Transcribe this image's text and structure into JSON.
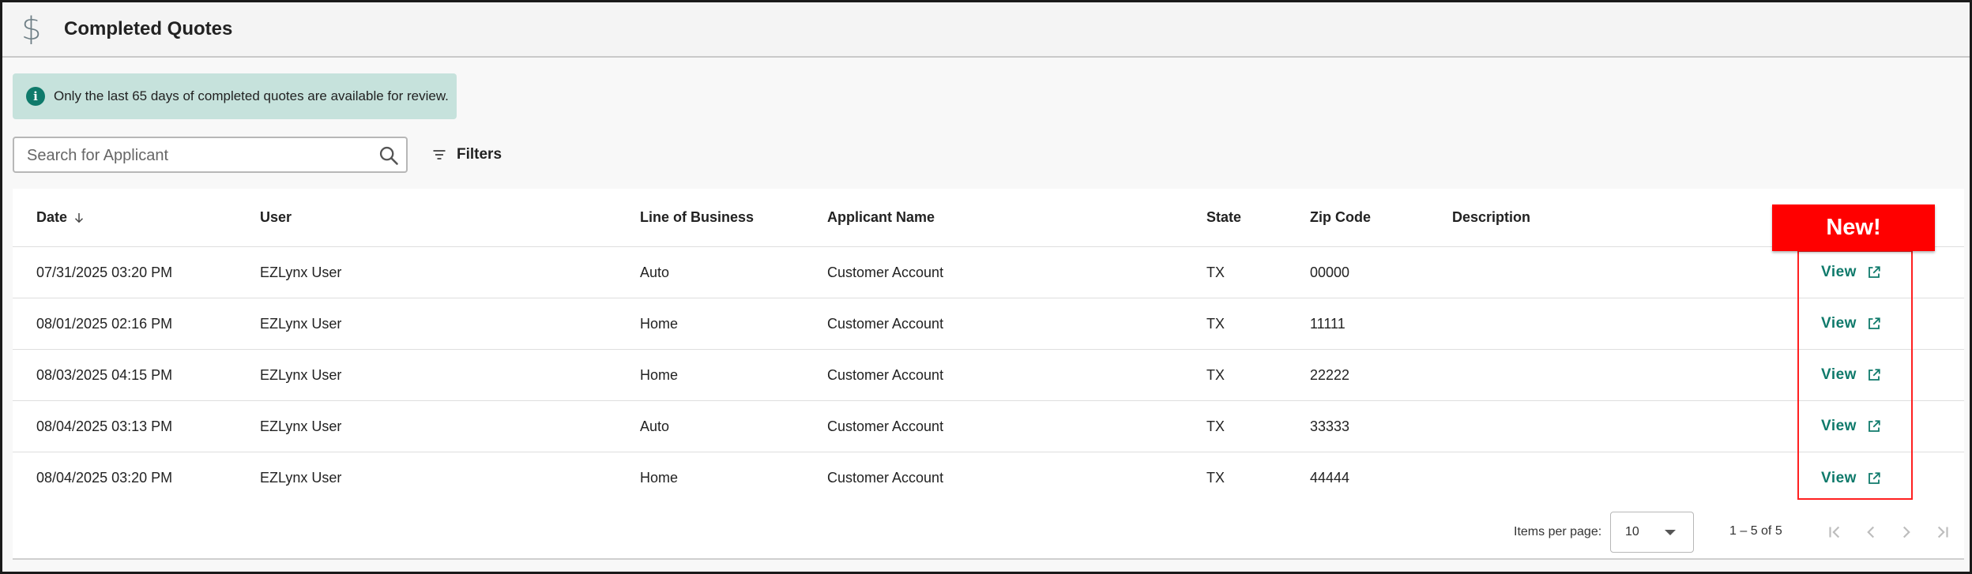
{
  "header": {
    "icon": "dollar-icon",
    "title": "Completed Quotes"
  },
  "notice": {
    "icon": "info-icon",
    "text": "Only the last 65 days of completed quotes are available for review."
  },
  "search": {
    "placeholder": "Search for Applicant",
    "value": "",
    "icon": "search-icon"
  },
  "filters": {
    "icon": "filter-icon",
    "label": "Filters"
  },
  "table": {
    "columns": {
      "date": "Date",
      "user": "User",
      "line_of_business": "Line of Business",
      "applicant_name": "Applicant Name",
      "state": "State",
      "zip_code": "Zip Code",
      "description": "Description"
    },
    "sort": {
      "column": "date",
      "direction": "descending",
      "icon": "arrow-down-icon"
    },
    "rows": [
      {
        "date": "07/31/2025 03:20 PM",
        "user": "EZLynx User",
        "line_of_business": "Auto",
        "applicant_name": "Customer Account",
        "state": "TX",
        "zip_code": "00000",
        "description": "",
        "action": "View"
      },
      {
        "date": "08/01/2025 02:16 PM",
        "user": "EZLynx User",
        "line_of_business": "Home",
        "applicant_name": "Customer Account",
        "state": "TX",
        "zip_code": "11111",
        "description": "",
        "action": "View"
      },
      {
        "date": "08/03/2025 04:15 PM",
        "user": "EZLynx User",
        "line_of_business": "Home",
        "applicant_name": "Customer Account",
        "state": "TX",
        "zip_code": "22222",
        "description": "",
        "action": "View"
      },
      {
        "date": "08/04/2025 03:13 PM",
        "user": "EZLynx User",
        "line_of_business": "Auto",
        "applicant_name": "Customer Account",
        "state": "TX",
        "zip_code": "33333",
        "description": "",
        "action": "View"
      },
      {
        "date": "08/04/2025 03:20 PM",
        "user": "EZLynx User",
        "line_of_business": "Home",
        "applicant_name": "Customer Account",
        "state": "TX",
        "zip_code": "44444",
        "description": "",
        "action": "View"
      }
    ]
  },
  "paginator": {
    "items_per_page_label": "Items per page:",
    "items_per_page": "10",
    "range": "1 – 5 of 5"
  },
  "annotation": {
    "badge": "New!"
  },
  "colors": {
    "accent": "#0f7a6b",
    "notice_bg": "#c6e2dc",
    "callout_red": "#ff0000"
  }
}
